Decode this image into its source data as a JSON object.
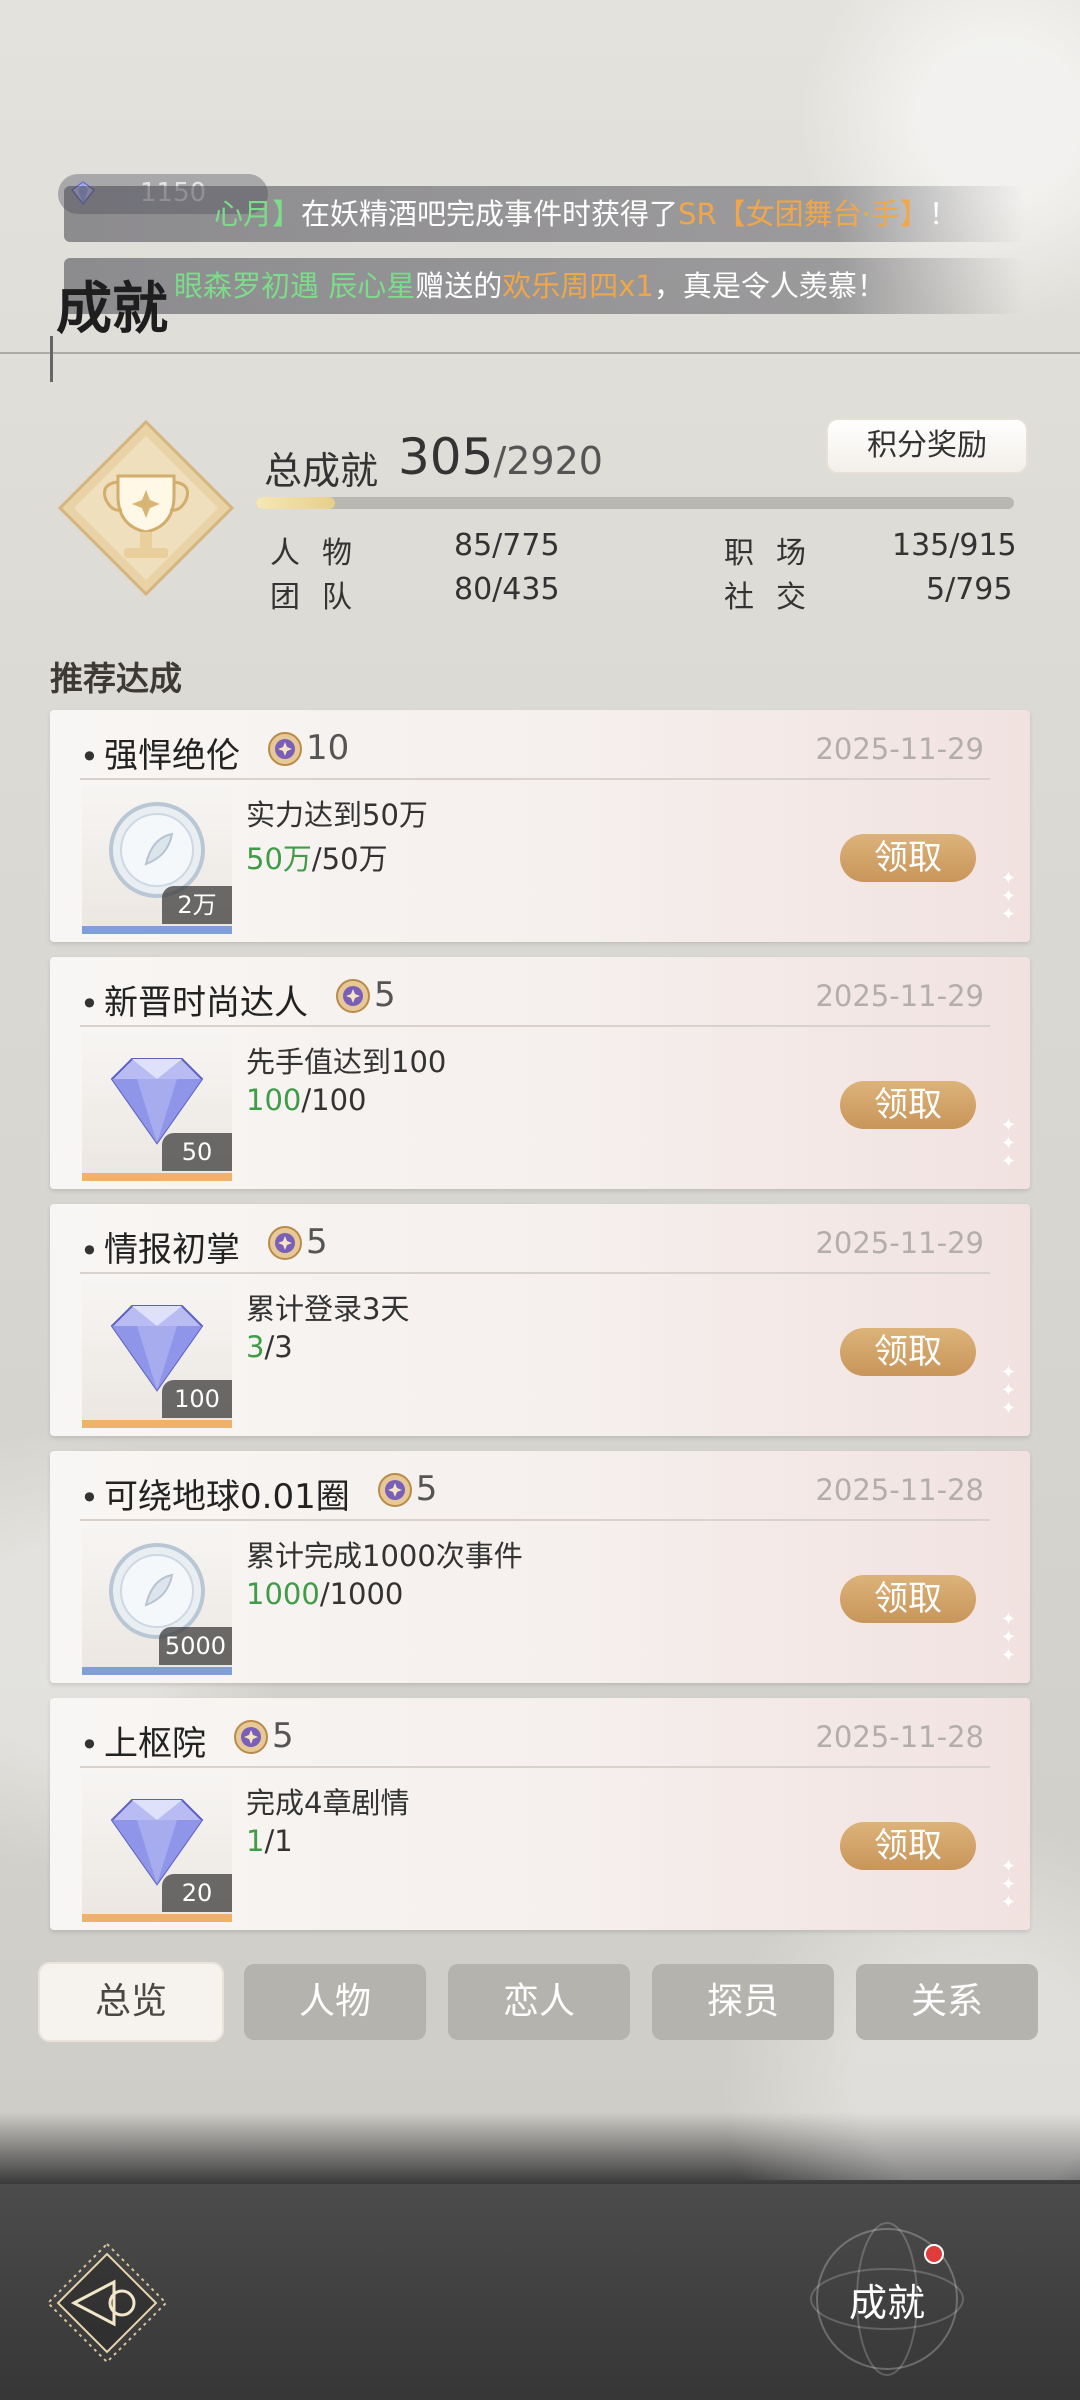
{
  "currency": {
    "value": "1150",
    "plus": "+"
  },
  "tickers": [
    {
      "prefix_hl": "心月】",
      "mid": "在妖精酒吧完成事件时获得了",
      "item_hl": "SR【女团舞台·手】",
      "suffix": "！"
    },
    {
      "prefix_hl": "眼森罗初遇 辰心星",
      "mid": "赠送的",
      "item_hl": "欢乐周四x1",
      "suffix": "，真是令人羡慕！"
    }
  ],
  "header": {
    "title": "成就"
  },
  "summary": {
    "total_label": "总成就",
    "total_value": "305",
    "total_max": "/2920",
    "progress_fraction": 0.104,
    "reward_button": "积分奖励",
    "stats": [
      {
        "label": "人物",
        "value": "85/775"
      },
      {
        "label": "职场",
        "value": "135/915"
      },
      {
        "label": "团队",
        "value": "80/435"
      },
      {
        "label": "社交",
        "value": "5/795"
      }
    ]
  },
  "section_title": "推荐达成",
  "cards": [
    {
      "name": "强悍绝伦",
      "points": "10",
      "date": "2025-11-29",
      "item": "coin",
      "item_count": "2万",
      "desc": "实力达到50万",
      "progress_done": "50万",
      "progress_total": "/50万",
      "claim": "领取"
    },
    {
      "name": "新晋时尚达人",
      "points": "5",
      "date": "2025-11-29",
      "item": "diamond",
      "item_count": "50",
      "desc": "先手值达到100",
      "progress_done": "100",
      "progress_total": "/100",
      "claim": "领取"
    },
    {
      "name": "情报初掌",
      "points": "5",
      "date": "2025-11-29",
      "item": "diamond",
      "item_count": "100",
      "desc": "累计登录3天",
      "progress_done": "3",
      "progress_total": "/3",
      "claim": "领取"
    },
    {
      "name": "可绕地球0.01圈",
      "points": "5",
      "date": "2025-11-28",
      "item": "coin",
      "item_count": "5000",
      "desc": "累计完成1000次事件",
      "progress_done": "1000",
      "progress_total": "/1000",
      "claim": "领取"
    },
    {
      "name": "上枢院",
      "points": "5",
      "date": "2025-11-28",
      "item": "diamond",
      "item_count": "20",
      "desc": "完成4章剧情",
      "progress_done": "1",
      "progress_total": "/1",
      "claim": "领取"
    }
  ],
  "tabs": [
    "总览",
    "人物",
    "恋人",
    "探员",
    "关系"
  ],
  "bottom": {
    "achievement_label": "成就"
  },
  "colors": {
    "accent_gold": "#c8955a",
    "progress_green": "#3f9c47",
    "notify_red": "#e23b3b"
  }
}
